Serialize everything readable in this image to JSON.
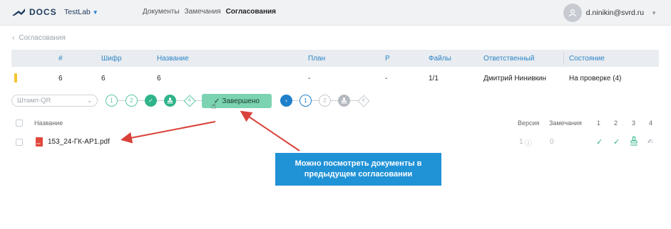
{
  "app": {
    "logo_text": "DOCS",
    "project": "TestLab"
  },
  "nav": {
    "items": [
      "Документы",
      "Замечания",
      "Согласования"
    ],
    "active_index": 2
  },
  "user": {
    "email": "d.ninikin@svrd.ru"
  },
  "breadcrumb": {
    "back_label": "Согласования"
  },
  "table": {
    "headers": {
      "num": "#",
      "code": "Шифр",
      "name": "Название",
      "plan": "План",
      "p": "Р",
      "files": "Файлы",
      "responsible": "Ответственный",
      "state": "Состояние"
    },
    "row": {
      "num": "6",
      "code": "6",
      "name": "6",
      "plan": "-",
      "p": "-",
      "files": "1/1",
      "responsible": "Дмитрий Нинивкин",
      "state": "На проверке (4)",
      "marker_color": "#f4c531"
    }
  },
  "toolbar": {
    "stamp_placeholder": "Штамп-QR",
    "done_label": "Завершено",
    "stages_prev": [
      "1",
      "2"
    ],
    "stage4_prev": "4",
    "stages_next": [
      "1",
      "2"
    ],
    "stage4_next": "4"
  },
  "files": {
    "headers": {
      "name": "Название",
      "version": "Версия",
      "remarks": "Замечания",
      "s1": "1",
      "s2": "2",
      "s3": "3",
      "s4": "4"
    },
    "rows": [
      {
        "name": "153_24-ГК-АР1.pdf",
        "version": "1",
        "remarks": "0"
      }
    ]
  },
  "callout": {
    "text": "Можно посмотреть документы в предыдущем согласовании",
    "color": "#2092d6"
  },
  "colors": {
    "accent": "#2a85c8",
    "success": "#2fb38a",
    "annotation": "#d9423a"
  }
}
